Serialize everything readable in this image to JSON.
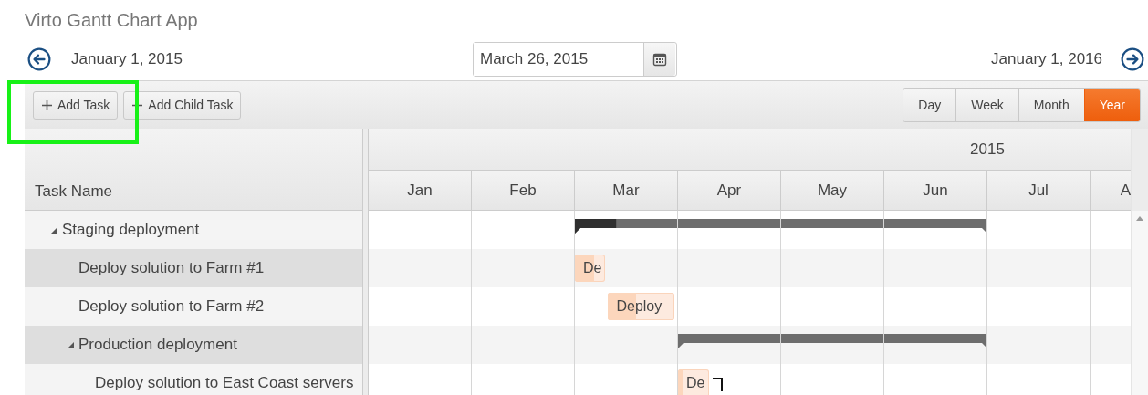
{
  "app_title": "Virto Gantt Chart App",
  "navigation": {
    "start_date": "January 1, 2015",
    "current_date": "March 26, 2015",
    "end_date": "January 1, 2016"
  },
  "toolbar": {
    "buttons": [
      "Add Task",
      "Add Child Task"
    ],
    "views": [
      {
        "label": "Day",
        "selected": false
      },
      {
        "label": "Week",
        "selected": false
      },
      {
        "label": "Month",
        "selected": false
      },
      {
        "label": "Year",
        "selected": true
      }
    ]
  },
  "task_column": "Task Name",
  "timeline": {
    "year": "2015",
    "months": [
      "Jan",
      "Feb",
      "Mar",
      "Apr",
      "May",
      "Jun",
      "Jul",
      "A"
    ]
  },
  "tasks": [
    {
      "name": "Staging deployment",
      "kind": "summary",
      "expanded": true,
      "level": 0.1,
      "children": [
        {
          "name": "Deploy solution to Farm #1",
          "kind": "task",
          "level": 0.65,
          "bar_label": "De"
        },
        {
          "name": "Deploy solution to Farm #2",
          "kind": "task",
          "level": 0.42,
          "bar_label": "Deploy"
        },
        {
          "name": "Production deployment",
          "kind": "summary",
          "expanded": true,
          "children": [
            {
              "name": "Deploy solution to East Coast servers",
              "kind": "task",
              "level": 0.15,
              "bar_label": "De"
            }
          ]
        }
      ]
    }
  ]
}
